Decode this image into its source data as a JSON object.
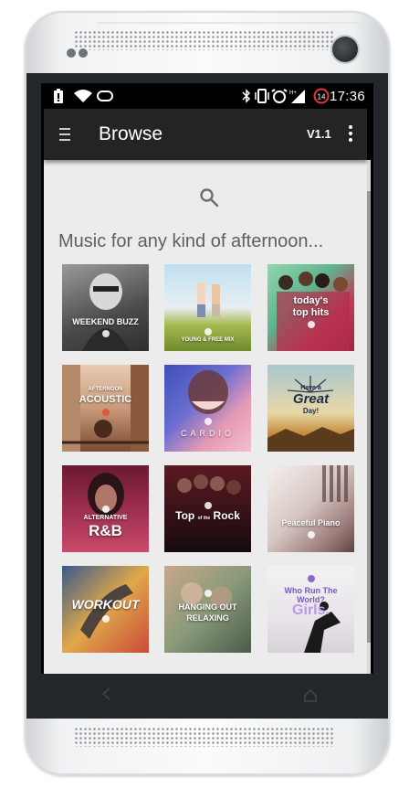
{
  "status_bar": {
    "time": "17:36",
    "notification_count": "14"
  },
  "toolbar": {
    "title": "Browse",
    "version": "V1.1"
  },
  "section": {
    "heading": "Music for any kind of afternoon..."
  },
  "playlists": [
    {
      "name": "Weekend Buzz",
      "line1": "WEEKEND BUZZ"
    },
    {
      "name": "Young & Free Mix",
      "line1": "YOUNG & FREE MIX"
    },
    {
      "name": "Today's Top Hits",
      "line1": "today's",
      "line2": "top hits"
    },
    {
      "name": "Afternoon Acoustic",
      "line1": "AFTERNOON",
      "line2": "ACOUSTIC"
    },
    {
      "name": "Cardio",
      "line1": "CARDIO"
    },
    {
      "name": "Have a Great Day!",
      "line1": "Have a",
      "line2": "Great",
      "line3": "Day!"
    },
    {
      "name": "Alternative R&B",
      "line1": "ALTERNATIVE",
      "line2": "R&B"
    },
    {
      "name": "Top of the Rock",
      "line1": "Top",
      "line2": "of the",
      "line3": "Rock"
    },
    {
      "name": "Peaceful Piano",
      "line1": "Peaceful Piano"
    },
    {
      "name": "Workout",
      "line1": "WORKOUT"
    },
    {
      "name": "Hanging Out & Relaxing",
      "line1": "HANGING OUT",
      "line2": "RELAXING"
    },
    {
      "name": "Who Run The World? Girls.",
      "line1": "Who Run The",
      "line2": "World?",
      "line3": "Girls."
    }
  ],
  "icons": {
    "status": [
      "battery-alert-icon",
      "wifi-icon",
      "cast-icon",
      "bluetooth-icon",
      "vibrate-icon",
      "alarm-icon",
      "signal-icon"
    ],
    "toolbar": [
      "menu-icon",
      "more-vert-icon"
    ],
    "content": [
      "search-icon"
    ],
    "nav": [
      "back-icon",
      "home-icon"
    ]
  },
  "colors": {
    "toolbar": "#242424",
    "content_bg": "#ececec",
    "status_bar": "#000000",
    "accent": "#e53935"
  }
}
